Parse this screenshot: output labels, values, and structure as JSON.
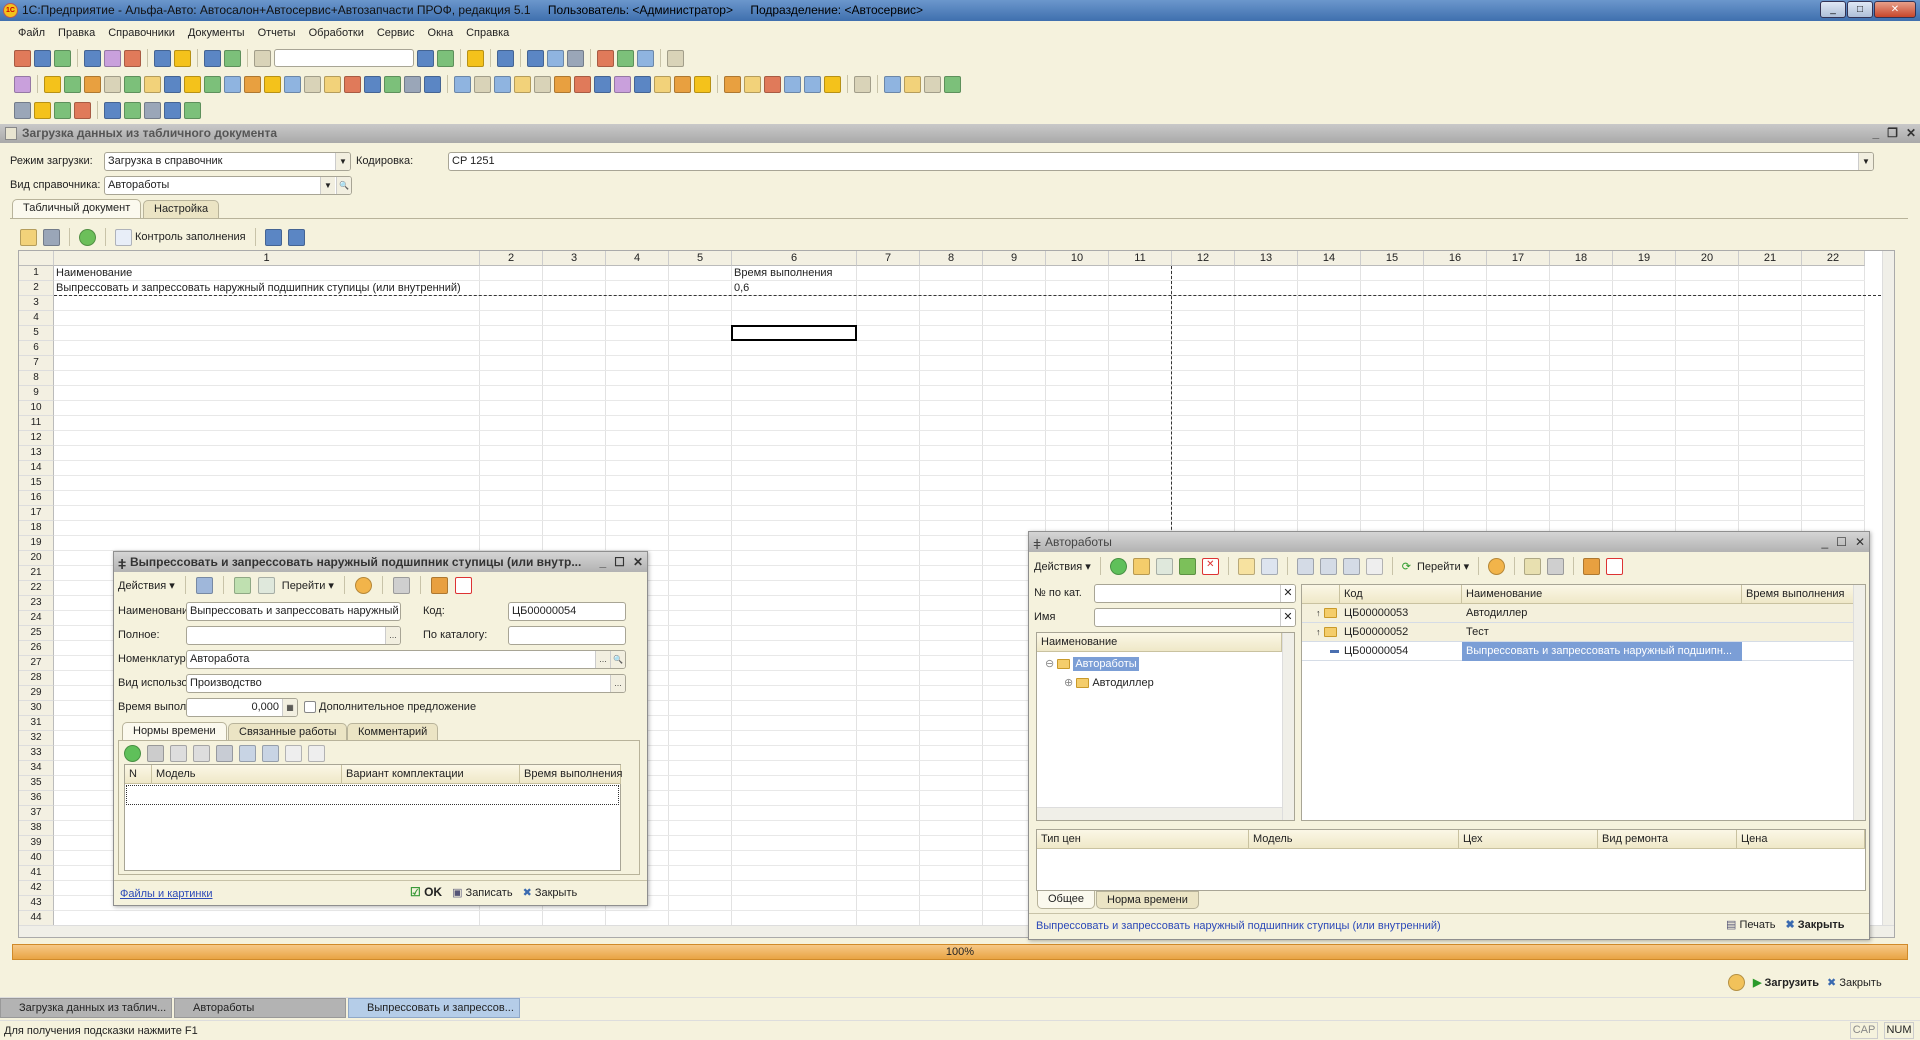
{
  "app": {
    "title": "1С:Предприятие - Альфа-Авто: Автосалон+Автосервис+Автозапчасти ПРОФ, редакция 5.1",
    "user": "Пользователь: <Администратор>",
    "division": "Подразделение: <Автосервис>"
  },
  "menu": [
    "Файл",
    "Правка",
    "Справочники",
    "Документы",
    "Отчеты",
    "Обработки",
    "Сервис",
    "Окна",
    "Справка"
  ],
  "toolbars": {
    "row1": [
      "new-doc-icon",
      "open-icon",
      "save-icon",
      "|",
      "cut-icon",
      "copy-icon",
      "paste-icon",
      "|",
      "print-icon",
      "preview-icon",
      "|",
      "undo-icon",
      "redo-icon",
      "|",
      "find-icon",
      "SEARCH",
      "find-next-icon",
      "find-prev-icon",
      "|",
      "windows-icon",
      "|",
      "info-icon",
      "|",
      "calculator-icon",
      "calendar-icon",
      "user-lock-icon",
      "|",
      "memory-m-icon",
      "memory-mplus-icon",
      "memory-mminus-icon",
      "|",
      "tools-icon"
    ],
    "row2": [
      "alfa-auto-icon",
      "|",
      "dealer-icon",
      "service-icon",
      "parts-icon",
      "storage-icon",
      "report-icon",
      "person-icon",
      "money-icon",
      "cabinet-icon",
      "cabinet2-icon",
      "employees-icon",
      "warehouse-icon",
      "structure-icon",
      "settings-icon",
      "monitor-icon",
      "doc-icon",
      "doc-plus-icon",
      "coins-icon",
      "chart-icon",
      "tool-icon",
      "list-icon",
      "|",
      "books-icon",
      "cars-icon",
      "person-plus-icon",
      "pko-icon",
      "rko-icon",
      "payment-icon",
      "plat-icon",
      "transfer-in-icon",
      "transfer-out-icon",
      "invoice-icon",
      "nakl-icon",
      "nakl2-icon",
      "nakl3-icon",
      "|",
      "doc2-icon",
      "doc-arrow-icon",
      "bars-icon",
      "coins2-icon",
      "doc-minus-icon",
      "dk-sum-icon",
      "|",
      "flag-icon",
      "|",
      "book-icon",
      "folder-icon",
      "coins3-icon",
      "green-icon"
    ],
    "row3": [
      "bell-icon",
      "car-icon",
      "gear-icon",
      "wrench-icon",
      "|",
      "tools2-icon",
      "hammer-icon",
      "nakl4-icon",
      "nakl5-icon",
      "nakl6-icon"
    ]
  },
  "doc_window": {
    "title": "Загрузка данных из табличного документа",
    "mode_label": "Режим загрузки:",
    "mode_value": "Загрузка в справочник",
    "encoding_label": "Кодировка:",
    "encoding_value": "CP 1251",
    "catalog_label": "Вид справочника:",
    "catalog_value": "Автоработы",
    "tabs": [
      "Табличный документ",
      "Настройка"
    ],
    "fill_control": "Контроль заполнения",
    "grid": {
      "columns": [
        "1",
        "2",
        "3",
        "4",
        "5",
        "6",
        "7",
        "8",
        "9",
        "10",
        "11",
        "12",
        "13",
        "14",
        "15",
        "16",
        "17",
        "18",
        "19",
        "20",
        "21",
        "22"
      ],
      "row_count": 44,
      "cells": [
        {
          "row": 1,
          "col": 1,
          "text": "Наименование"
        },
        {
          "row": 1,
          "col": 6,
          "text": "Время выполнения"
        },
        {
          "row": 2,
          "col": 1,
          "text": "Выпрессовать и запрессовать наружный подшипник ступицы (или внутренний)"
        },
        {
          "row": 2,
          "col": 6,
          "text": "0,6"
        }
      ],
      "selected": {
        "row": 5,
        "col": 6
      }
    },
    "progress": {
      "value": 100,
      "label": "100%"
    },
    "load_btn": "Загрузить",
    "close_btn": "Закрыть"
  },
  "item_dialog": {
    "title": "Выпрессовать и запрессовать наружный подшипник ступицы (или внутр...",
    "actions": "Действия",
    "goto": "Перейти",
    "name_label": "Наименование:",
    "name_value": "Выпрессовать и запрессовать наружный г",
    "code_label": "Код:",
    "code_value": "ЦБ00000054",
    "full_label": "Полное:",
    "full_value": "",
    "catalog_label": "По каталогу:",
    "catalog_value": "",
    "nomen_label": "Номенклатура:",
    "nomen_value": "Авторабота",
    "usage_label": "Вид использов-я:",
    "usage_value": "Производство",
    "time_label": "Время выпол-я:",
    "time_value": "0,000",
    "extra_label": "Дополнительное предложение",
    "extra_checked": false,
    "tabs": [
      "Нормы времени",
      "Связанные работы",
      "Комментарий"
    ],
    "table_cols": [
      "N",
      "Модель",
      "Вариант комплектации",
      "Время выполнения"
    ],
    "files_link": "Файлы и картинки",
    "ok": "OK",
    "save": "Записать",
    "close": "Закрыть"
  },
  "catalog_dialog": {
    "title": "Автоработы",
    "actions": "Действия",
    "goto": "Перейти",
    "cat_no_label": "№ по кат.",
    "name_label": "Имя",
    "tree_header": "Наименование",
    "tree": [
      {
        "label": "Автоработы",
        "selected": true,
        "expanded": true
      },
      {
        "label": "Автодиллер",
        "selected": false,
        "expanded": false
      }
    ],
    "list_cols": [
      "Код",
      "Наименование",
      "Время выполнения"
    ],
    "rows": [
      {
        "type": "folder",
        "code": "ЦБ00000053",
        "name": "Автодиллер",
        "time": ""
      },
      {
        "type": "folder",
        "code": "ЦБ00000052",
        "name": "Тест",
        "time": ""
      },
      {
        "type": "item",
        "code": "ЦБ00000054",
        "name": "Выпрессовать и запрессовать наружный подшипн...",
        "time": ""
      }
    ],
    "price_cols": [
      "Тип цен",
      "Модель",
      "Цех",
      "Вид ремонта",
      "Цена"
    ],
    "tabs": [
      "Общее",
      "Норма времени"
    ],
    "status": "Выпрессовать и запрессовать наружный подшипник ступицы (или внутренний)",
    "print": "Печать",
    "close": "Закрыть"
  },
  "taskbar": [
    "Загрузка данных из таблич...",
    "Автоработы",
    "Выпрессовать и запрессов..."
  ],
  "statusbar": {
    "hint": "Для получения подсказки нажмите F1",
    "cap": "CAP",
    "num": "NUM"
  },
  "colors": {
    "accent": "#3f6fae",
    "background": "#f5f2dd",
    "selection": "#7b9ed6",
    "progress": "#eba84a"
  }
}
